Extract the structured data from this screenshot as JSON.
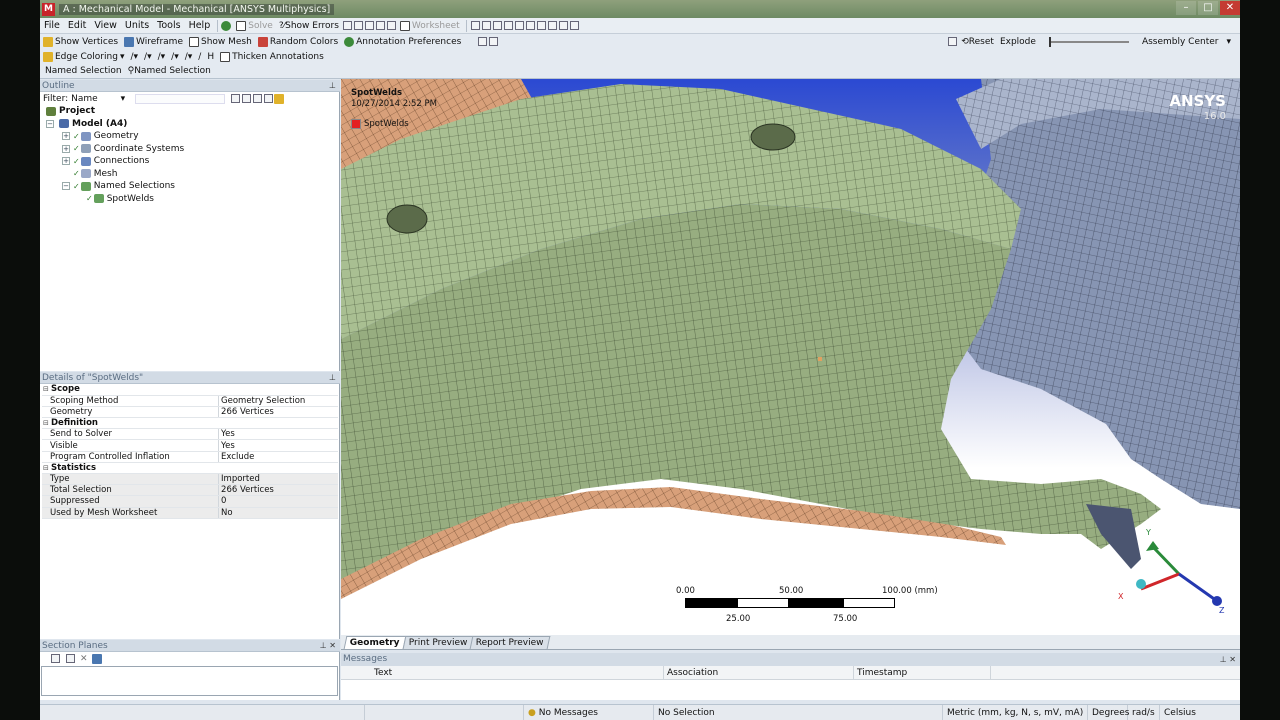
{
  "window": {
    "app_icon": "M",
    "title": "A : Mechanical Model - Mechanical [ANSYS Multiphysics]"
  },
  "menu": [
    "File",
    "Edit",
    "View",
    "Units",
    "Tools",
    "Help"
  ],
  "toolbar1": {
    "solve_label": "Solve",
    "show_errors_label": "Show Errors",
    "worksheet_label": "Worksheet"
  },
  "toolbar2": {
    "show_vertices": "Show Vertices",
    "wireframe": "Wireframe",
    "show_mesh": "Show Mesh",
    "random_colors": "Random Colors",
    "annotation_preferences": "Annotation Preferences",
    "reset": "Reset",
    "explode": "Explode",
    "assembly_center": "Assembly Center"
  },
  "toolbar3": {
    "edge_coloring": "Edge Coloring",
    "thicken_annotations": "Thicken Annotations"
  },
  "toolbar4": {
    "named_selection_label": "Named Selection",
    "named_selection_button": "Named Selection"
  },
  "outline": {
    "header": "Outline",
    "filter_label": "Filter:",
    "filter_value": "Name",
    "tree": [
      {
        "label": "Project",
        "bold": true
      },
      {
        "label": "Model (A4)",
        "bold": true
      },
      {
        "label": "Geometry"
      },
      {
        "label": "Coordinate Systems"
      },
      {
        "label": "Connections"
      },
      {
        "label": "Mesh"
      },
      {
        "label": "Named Selections"
      },
      {
        "label": "SpotWelds"
      }
    ]
  },
  "details": {
    "header": "Details of \"SpotWelds\"",
    "sections": {
      "scope": "Scope",
      "definition": "Definition",
      "statistics": "Statistics"
    },
    "rows": {
      "scoping_method": [
        "Scoping Method",
        "Geometry Selection"
      ],
      "geometry": [
        "Geometry",
        "266 Vertices"
      ],
      "send_to_solver": [
        "Send to Solver",
        "Yes"
      ],
      "visible": [
        "Visible",
        "Yes"
      ],
      "inflation": [
        "Program Controlled Inflation",
        "Exclude"
      ],
      "type": [
        "Type",
        "Imported"
      ],
      "total_selection": [
        "Total Selection",
        "266 Vertices"
      ],
      "suppressed": [
        "Suppressed",
        "0"
      ],
      "used_by_mesh_ws": [
        "Used by Mesh Worksheet",
        "No"
      ]
    }
  },
  "section_planes": {
    "header": "Section Planes"
  },
  "viewport": {
    "object_title": "SpotWelds",
    "timestamp": "10/27/2014 2:52 PM",
    "legend_label": "SpotWelds",
    "legend_color": "#e42020",
    "logo": "ANSYS",
    "version": "16.0",
    "scale": {
      "top_labels": [
        "0.00",
        "50.00",
        "100.00 (mm)"
      ],
      "bottom_labels": [
        "25.00",
        "75.00"
      ]
    },
    "triad": {
      "x": "X",
      "y": "Y",
      "z": "Z"
    }
  },
  "view_tabs": [
    "Geometry",
    "Print Preview",
    "Report Preview"
  ],
  "messages": {
    "header": "Messages",
    "columns": [
      "Text",
      "Association",
      "Timestamp"
    ]
  },
  "statusbar": {
    "messages": "No Messages",
    "selection": "No Selection",
    "units": "Metric (mm, kg, N, s, mV, mA)",
    "angle": "Degrees",
    "rate": "rad/s",
    "temperature": "Celsius"
  },
  "colors": {
    "mesh_green": "#a9bf92",
    "mesh_blue": "#8795b3",
    "mesh_orange": "#d8a07a",
    "background_top": "#2b49d2"
  }
}
